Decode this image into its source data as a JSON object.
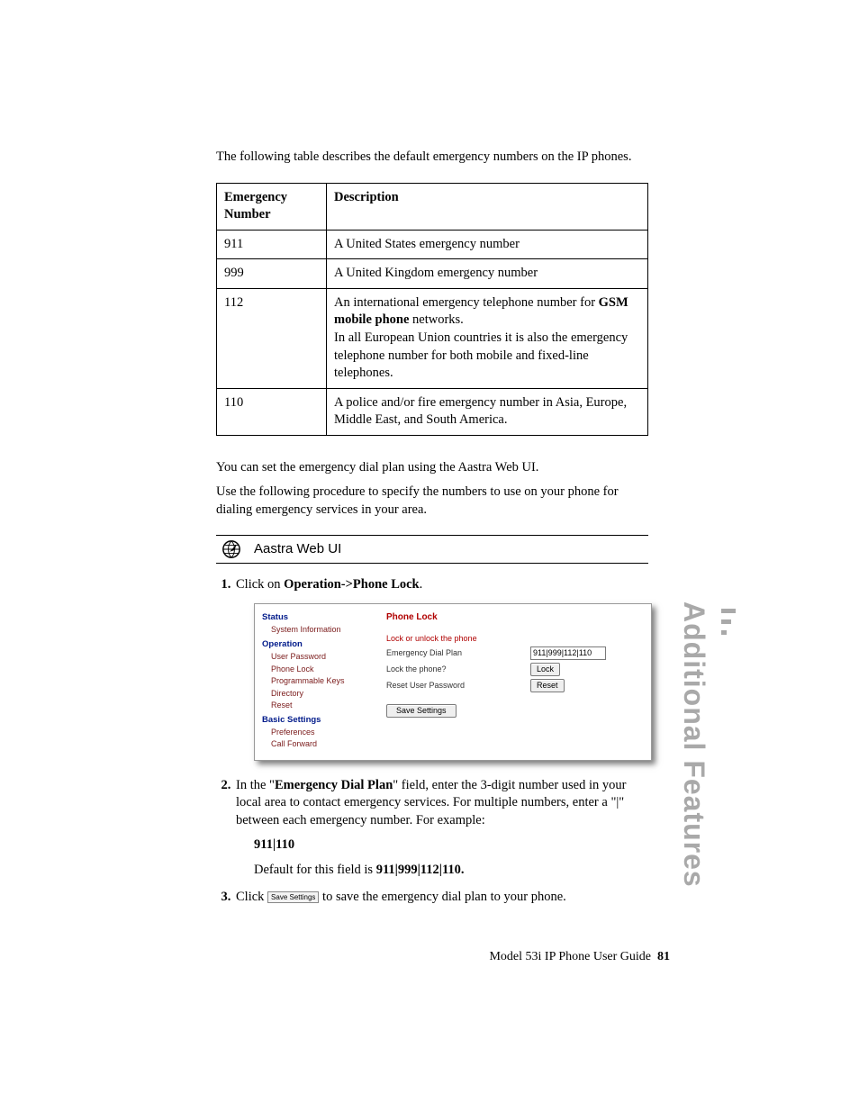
{
  "intro": "The following table describes the default emergency numbers on the IP phones.",
  "table": {
    "headers": [
      "Emergency Number",
      "Description"
    ],
    "rows": [
      {
        "num": "911",
        "desc_plain": "A United States emergency number"
      },
      {
        "num": "999",
        "desc_plain": "A United Kingdom emergency number"
      },
      {
        "num": "112",
        "desc_before": "An international emergency telephone number for ",
        "desc_bold": "GSM mobile phone",
        "desc_mid": " networks.",
        "desc_after": "In all European Union countries it is also the emergency telephone number for both mobile and fixed-line telephones."
      },
      {
        "num": "110",
        "desc_plain": "A police and/or fire emergency number in Asia, Europe, Middle East, and South America."
      }
    ]
  },
  "para2": "You can set the emergency dial plan using the Aastra Web UI.",
  "para3": "Use the following procedure to specify the numbers to use on your phone for dialing emergency services in your area.",
  "webui_label": "Aastra Web UI",
  "steps": {
    "s1_a": "Click on ",
    "s1_b": "Operation->Phone Lock",
    "s1_c": ".",
    "s2_a": "In the \"",
    "s2_b": "Emergency Dial Plan",
    "s2_c": "\" field, enter the 3-digit number used in your local area to contact emergency services. For multiple numbers, enter a \"|\" between each emergency number. For example:",
    "s2_example": "911|110",
    "s2_def_a": "Default for this field is ",
    "s2_def_b": "911|999|112|110.",
    "s3_a": "Click ",
    "s3_btn": "Save Settings",
    "s3_b": " to save the emergency dial plan to your phone."
  },
  "shot": {
    "nav": {
      "status": "Status",
      "status_items": [
        "System Information"
      ],
      "operation": "Operation",
      "operation_items": [
        "User Password",
        "Phone Lock",
        "Programmable Keys",
        "Directory",
        "Reset"
      ],
      "basic": "Basic Settings",
      "basic_items": [
        "Preferences",
        "Call Forward"
      ]
    },
    "title": "Phone Lock",
    "link_unlock": "Lock or unlock the phone",
    "rows": {
      "edp_label": "Emergency Dial Plan",
      "edp_value": "911|999|112|110",
      "lock_label": "Lock the phone?",
      "lock_btn": "Lock",
      "reset_label": "Reset User Password",
      "reset_btn": "Reset"
    },
    "save_btn": "Save Settings"
  },
  "side_tab": "Additional Features",
  "footer": {
    "title": "Model 53i IP Phone User Guide",
    "page": "81"
  }
}
